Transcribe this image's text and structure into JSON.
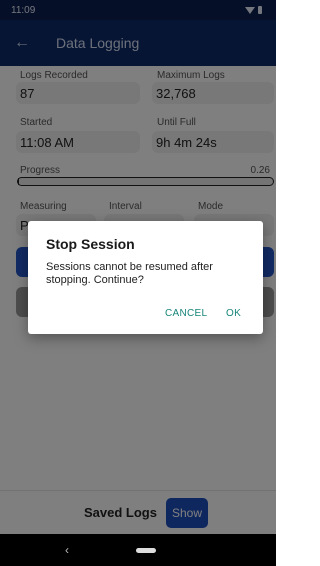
{
  "status_bar": {
    "time": "11:09"
  },
  "app_bar": {
    "title": "Data Logging"
  },
  "fields": {
    "logs_recorded": {
      "label": "Logs Recorded",
      "value": "87"
    },
    "maximum_logs": {
      "label": "Maximum Logs",
      "value": "32,768"
    },
    "started": {
      "label": "Started",
      "value": "11:08 AM"
    },
    "until_full": {
      "label": "Until Full",
      "value": "9h 4m 24s"
    }
  },
  "progress": {
    "label": "Progress",
    "value_text": "0.26",
    "fraction": 0.0026
  },
  "options": {
    "measuring_label": "Measuring",
    "measuring_value": "P",
    "interval_label": "Interval",
    "mode_label": "Mode"
  },
  "bottom": {
    "saved_logs_label": "Saved Logs",
    "show_label": "Show"
  },
  "dialog": {
    "title": "Stop Session",
    "message": "Sessions cannot be resumed after stopping. Continue?",
    "cancel_label": "CANCEL",
    "ok_label": "OK"
  },
  "colors": {
    "app_bar": "#0e2a6b",
    "accent": "#2456c8",
    "dialog_button": "#16857a"
  }
}
